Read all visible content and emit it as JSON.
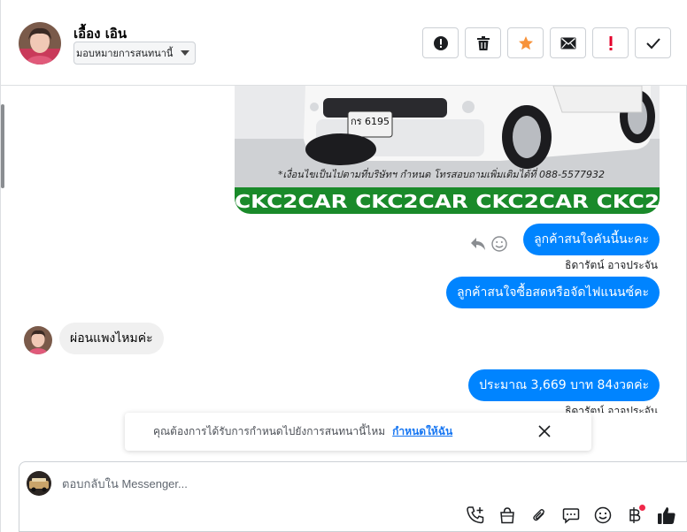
{
  "header": {
    "contact_name": "เอื้อง เอิน",
    "assign_label": "มอบหมายการสนทนานี้",
    "actions": [
      {
        "name": "spam-button",
        "icon": "alert-circle-icon"
      },
      {
        "name": "delete-button",
        "icon": "trash-icon"
      },
      {
        "name": "star-button",
        "icon": "star-icon"
      },
      {
        "name": "mark-unread-button",
        "icon": "envelope-icon"
      },
      {
        "name": "follow-up-button",
        "icon": "exclamation-icon"
      },
      {
        "name": "done-button",
        "icon": "check-icon"
      }
    ]
  },
  "car_image": {
    "plate_text": "กร 6195",
    "caption": "*เงื่อนไขเป็นไปตามที่บริษัทฯ กำหนด โทรสอบถามเพิ่มเติมได้ที่ 088-5577932",
    "banner": "CKC2CAR CKC2CAR CKC2CAR CKC2"
  },
  "messages": [
    {
      "text": "ลูกค้าสนใจคันนี้นะคะ",
      "sender": "ธิดารัตน์ อาจประจัน"
    },
    {
      "text": "ลูกค้าสนใจซื้อสดหรือจัดไฟแนนซ์คะ"
    },
    {
      "text": "ผ่อนแพงไหมค่ะ"
    },
    {
      "text": "ประมาณ 3,669 บาท 84งวดค่ะ",
      "sender": "ธิดารัตน์ อาจประจัน"
    }
  ],
  "notice": {
    "text": "คุณต้องการได้รับการกำหนดไปยังการสนทนานี้ไหม",
    "link": "กำหนดให้ฉัน"
  },
  "composer": {
    "placeholder": "ตอบกลับใน Messenger..."
  },
  "colors": {
    "accent": "#0084ff",
    "star": "#f7923a",
    "follow_up": "#e4002b",
    "banner_green": "#1a8a2a"
  }
}
